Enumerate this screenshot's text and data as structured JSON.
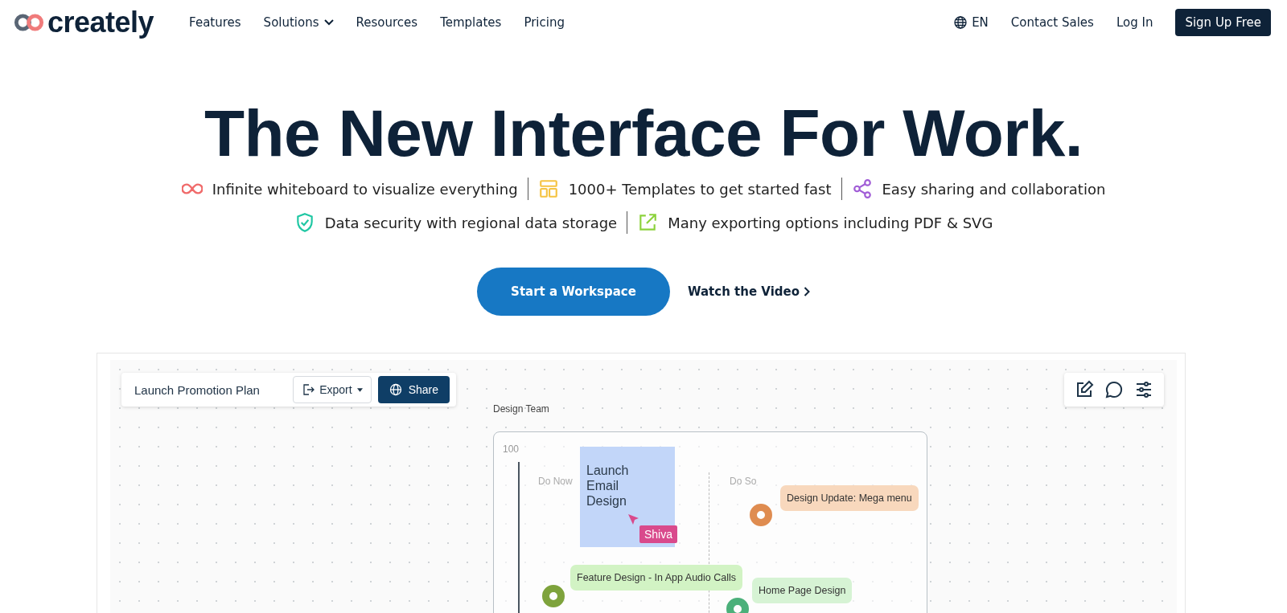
{
  "header": {
    "logo": "creately",
    "nav": [
      {
        "label": "Features",
        "dropdown": false
      },
      {
        "label": "Solutions",
        "dropdown": true
      },
      {
        "label": "Resources",
        "dropdown": false
      },
      {
        "label": "Templates",
        "dropdown": false
      },
      {
        "label": "Pricing",
        "dropdown": false
      }
    ],
    "language": "EN",
    "contact": "Contact Sales",
    "login": "Log In",
    "signup": "Sign Up Free"
  },
  "hero": {
    "title": "The New Interface For Work.",
    "feature_rows": [
      [
        {
          "kind": "infinity",
          "color": "#f06a6a",
          "text": "Infinite whiteboard to visualize everything"
        },
        {
          "kind": "template",
          "color": "#f5c342",
          "text": "1000+ Templates to get started fast"
        },
        {
          "kind": "share",
          "color": "#a05cd6",
          "text": "Easy sharing and collaboration"
        }
      ],
      [
        {
          "kind": "shield",
          "color": "#1fc7a3",
          "text": "Data security with regional data storage"
        },
        {
          "kind": "export",
          "color": "#8cd23c",
          "text": "Many exporting options including PDF & SVG"
        }
      ]
    ],
    "primary_button": "Start a Workspace",
    "video_link": "Watch the Video"
  },
  "demo": {
    "document_title": "Launch Promotion Plan",
    "export_button": "Export",
    "share_button": "Share",
    "frame_label": "Design Team",
    "axis_label": "100",
    "columns": [
      "Do Now",
      "Do So"
    ],
    "sticky_note": "Launch Email Design",
    "cursor_name": "Shiva",
    "cards": [
      {
        "text": "Design Update: Mega menu",
        "color": "#f8d8bd"
      },
      {
        "text": "Feature Design - In App Audio Calls",
        "color": "#d2f3c4"
      },
      {
        "text": "Home Page Design",
        "color": "#d6f3d4"
      }
    ],
    "markers": [
      {
        "color": "#df8c50"
      },
      {
        "color": "#7ea33c"
      },
      {
        "color": "#4bb07a"
      }
    ]
  }
}
